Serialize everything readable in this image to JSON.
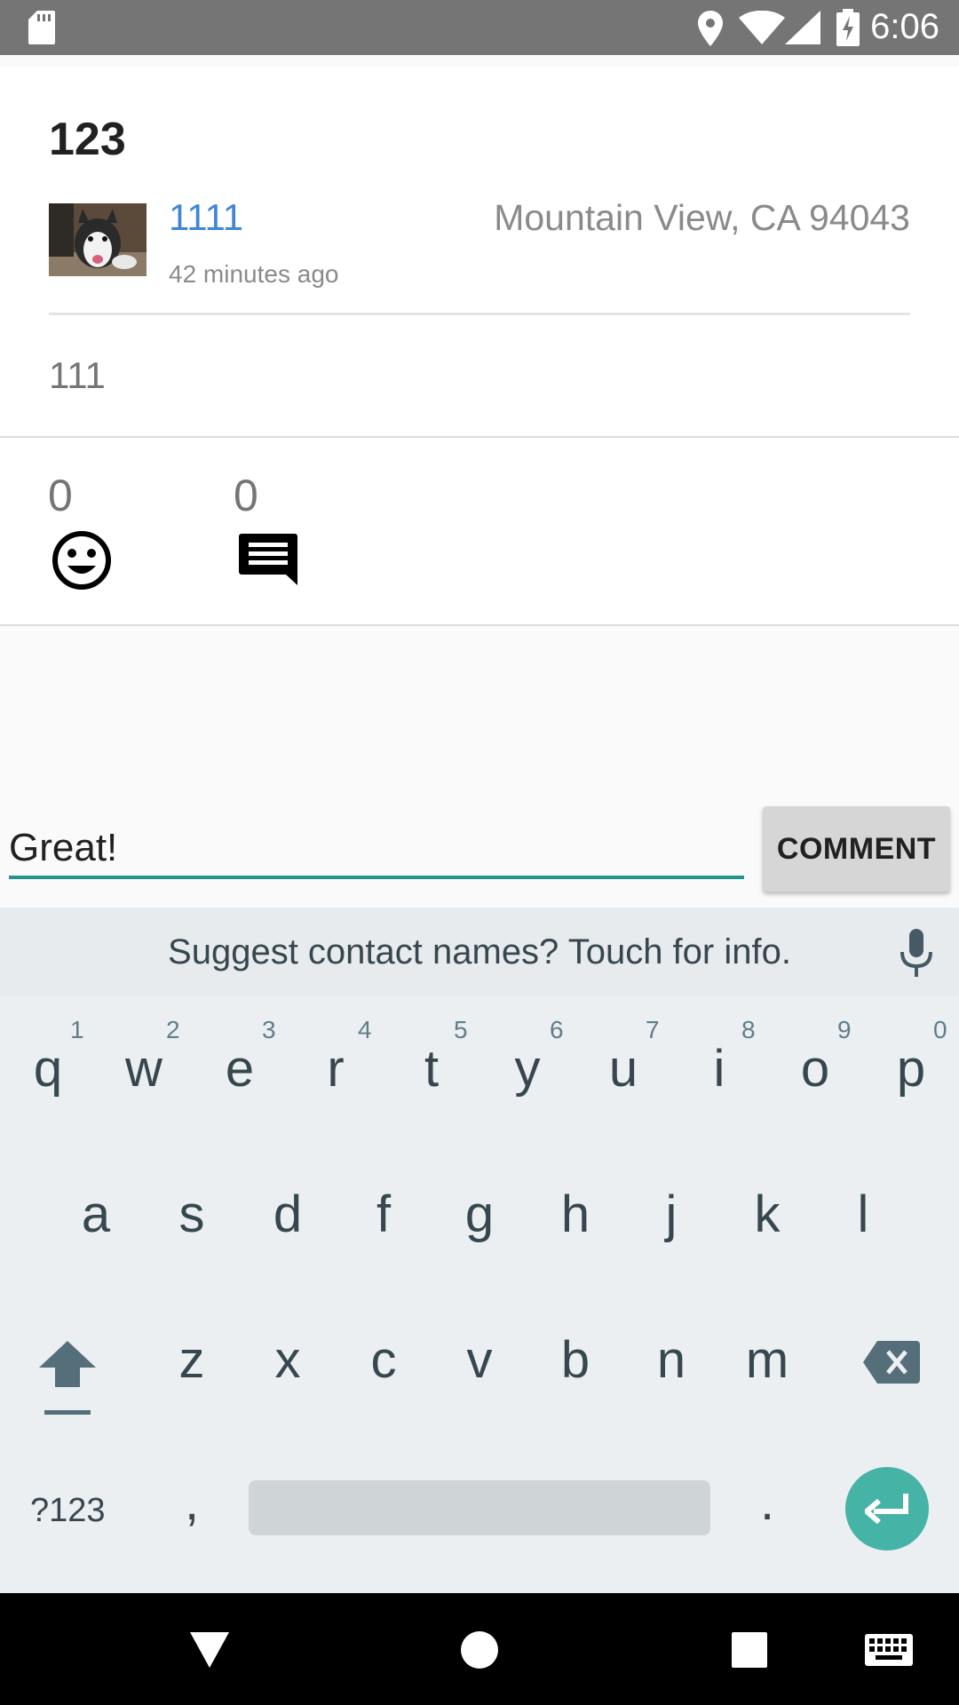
{
  "status_bar": {
    "time": "6:06"
  },
  "post": {
    "title": "123",
    "author": "1111",
    "time_ago": "42 minutes ago",
    "location": "Mountain View,  CA 94043",
    "body": "111",
    "reactions": {
      "smile_count": "0",
      "comment_count": "0"
    }
  },
  "comment_form": {
    "input_value": "Great!",
    "button_label": "COMMENT"
  },
  "keyboard": {
    "suggestion": "Suggest contact names? Touch for info.",
    "row1": [
      "q",
      "w",
      "e",
      "r",
      "t",
      "y",
      "u",
      "i",
      "o",
      "p"
    ],
    "row1_hints": [
      "1",
      "2",
      "3",
      "4",
      "5",
      "6",
      "7",
      "8",
      "9",
      "0"
    ],
    "row2": [
      "a",
      "s",
      "d",
      "f",
      "g",
      "h",
      "j",
      "k",
      "l"
    ],
    "row3": [
      "z",
      "x",
      "c",
      "v",
      "b",
      "n",
      "m"
    ],
    "symbols_key": "?123",
    "comma_key": ",",
    "period_key": "."
  }
}
